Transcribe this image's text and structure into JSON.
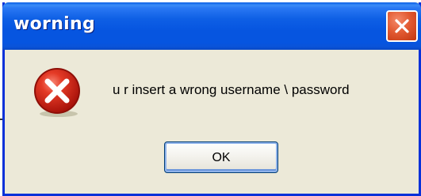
{
  "dialog": {
    "title": "worning",
    "message": "u r insert a wrong username \\ password",
    "ok_label": "OK",
    "icon": "error-icon",
    "close_icon": "close-icon"
  },
  "colors": {
    "titlebar": "#0655e0",
    "frame": "#0831d9",
    "body": "#ece9d8",
    "close_button": "#e25a32",
    "error_icon": "#d8261a"
  }
}
